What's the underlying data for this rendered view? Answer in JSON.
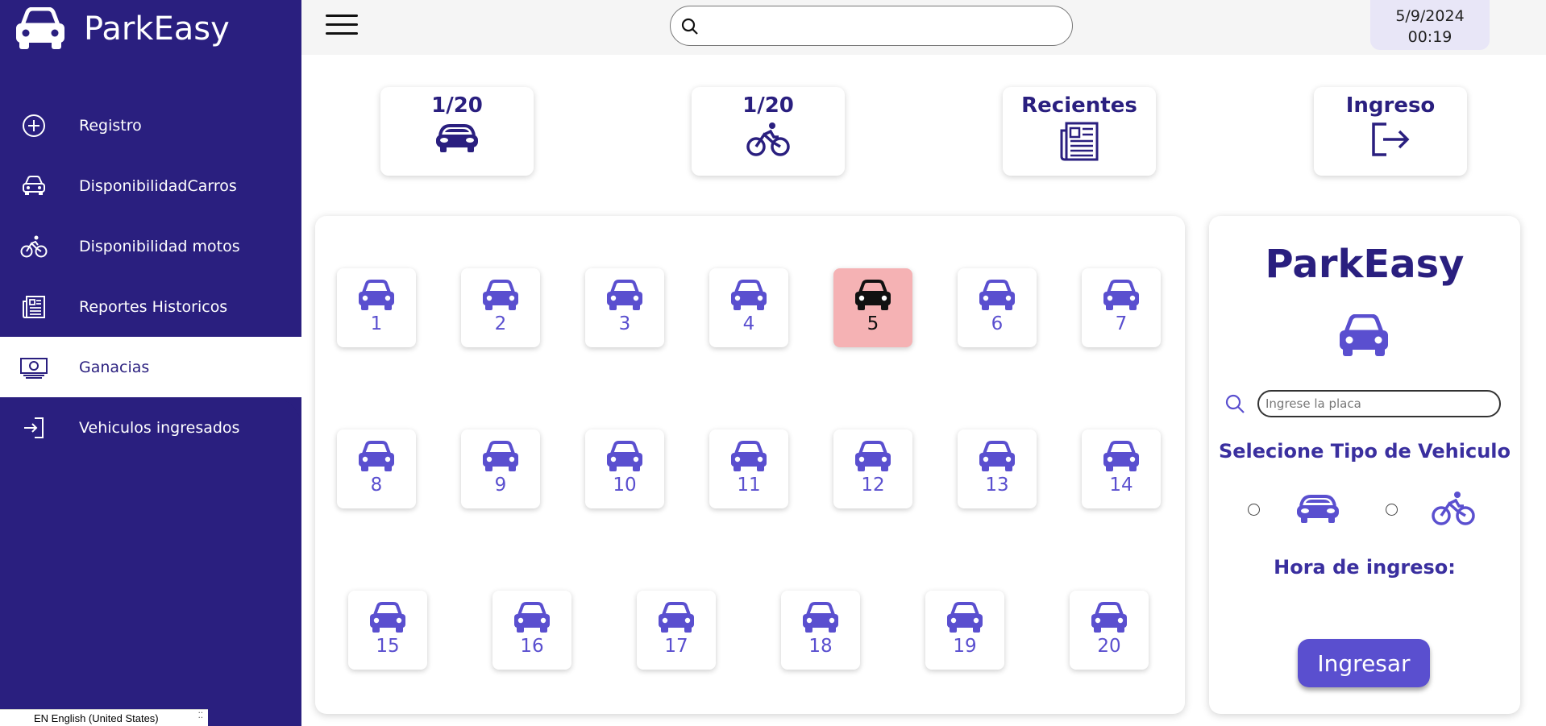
{
  "app": {
    "name": "ParkEasy"
  },
  "sidebar": {
    "items": [
      {
        "label": "Registro",
        "icon": "plus-circle-icon"
      },
      {
        "label": "DisponibilidadCarros",
        "icon": "car-icon"
      },
      {
        "label": "Disponibilidad motos",
        "icon": "bicycle-icon"
      },
      {
        "label": "Reportes Historicos",
        "icon": "report-icon"
      },
      {
        "label": "Ganacias",
        "icon": "money-icon",
        "active": true
      },
      {
        "label": "Vehiculos ingresados",
        "icon": "sign-in-icon"
      }
    ],
    "language": "EN English (United States)"
  },
  "topbar": {
    "search_value": "",
    "date": "5/9/2024",
    "time": "00:19"
  },
  "stats": [
    {
      "title": "1/20",
      "icon": "car-front-icon"
    },
    {
      "title": "1/20",
      "icon": "bicycle-icon"
    },
    {
      "title": "Recientes",
      "icon": "newspaper-icon"
    },
    {
      "title": "Ingreso",
      "icon": "exit-icon"
    }
  ],
  "slots": [
    {
      "n": "1"
    },
    {
      "n": "2"
    },
    {
      "n": "3"
    },
    {
      "n": "4"
    },
    {
      "n": "5",
      "occupied": true
    },
    {
      "n": "6"
    },
    {
      "n": "7"
    },
    {
      "n": "8"
    },
    {
      "n": "9"
    },
    {
      "n": "10"
    },
    {
      "n": "11"
    },
    {
      "n": "12"
    },
    {
      "n": "13"
    },
    {
      "n": "14"
    },
    {
      "n": "15"
    },
    {
      "n": "16"
    },
    {
      "n": "17"
    },
    {
      "n": "18"
    },
    {
      "n": "19"
    },
    {
      "n": "20"
    }
  ],
  "form": {
    "title": "ParkEasy",
    "plate_placeholder": "Ingrese la placa",
    "plate_value": "",
    "vehicle_type_label": "Selecione Tipo de Vehiculo",
    "hour_label": "Hora de ingreso:",
    "submit_label": "Ingresar"
  },
  "colors": {
    "sidebar": "#2a1f7f",
    "accent": "#5a4fcf",
    "occupied": "#f5b2b4"
  }
}
